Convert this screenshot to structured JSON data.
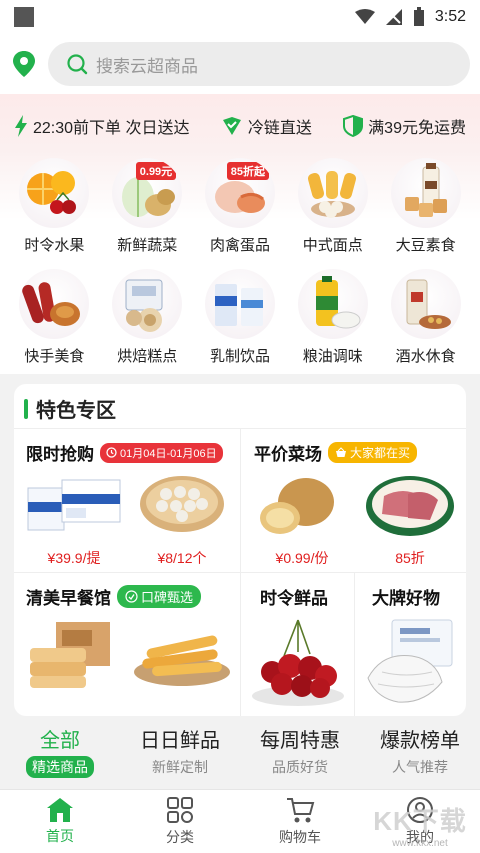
{
  "status_bar": {
    "time": "3:52"
  },
  "search": {
    "placeholder": "搜索云超商品"
  },
  "promises": [
    {
      "text": "22:30前下单 次日送达",
      "icon": "lightning-icon"
    },
    {
      "text": "冷链直送",
      "icon": "check-shield-icon"
    },
    {
      "text": "满39元免运费",
      "icon": "half-shield-icon"
    }
  ],
  "categories": [
    {
      "label": "时令水果",
      "tag": ""
    },
    {
      "label": "新鲜蔬菜",
      "tag": "0.99元"
    },
    {
      "label": "肉禽蛋品",
      "tag": "85折起"
    },
    {
      "label": "中式面点",
      "tag": ""
    },
    {
      "label": "大豆素食",
      "tag": ""
    },
    {
      "label": "快手美食",
      "tag": ""
    },
    {
      "label": "烘焙糕点",
      "tag": ""
    },
    {
      "label": "乳制饮品",
      "tag": ""
    },
    {
      "label": "粮油调味",
      "tag": ""
    },
    {
      "label": "酒水休食",
      "tag": ""
    }
  ],
  "feature": {
    "title": "特色专区",
    "flash_sale": {
      "title": "限时抢购",
      "badge": "01月04日-01月06日",
      "price1": "¥39.9/提",
      "price2": "¥8/12个"
    },
    "fair_price": {
      "title": "平价菜场",
      "badge": "大家都在买",
      "price1": "¥0.99/份",
      "price2": "85折"
    },
    "breakfast": {
      "title": "清美早餐馆",
      "badge": "口碑甄选"
    },
    "seasonal": {
      "title": "时令鲜品"
    },
    "brands": {
      "title": "大牌好物"
    }
  },
  "tabs": [
    {
      "main": "全部",
      "sub": "精选商品"
    },
    {
      "main": "日日鲜品",
      "sub": "新鲜定制"
    },
    {
      "main": "每周特惠",
      "sub": "品质好货"
    },
    {
      "main": "爆款榜单",
      "sub": "人气推荐"
    }
  ],
  "nav": [
    {
      "label": "首页",
      "icon": "home-icon"
    },
    {
      "label": "分类",
      "icon": "category-icon"
    },
    {
      "label": "购物车",
      "icon": "cart-icon"
    },
    {
      "label": "我的",
      "icon": "profile-icon"
    }
  ],
  "watermark": {
    "big": "KK下载",
    "small": "www.kkx.net"
  },
  "colors": {
    "accent": "#22b14c",
    "price_red": "#e02020"
  }
}
